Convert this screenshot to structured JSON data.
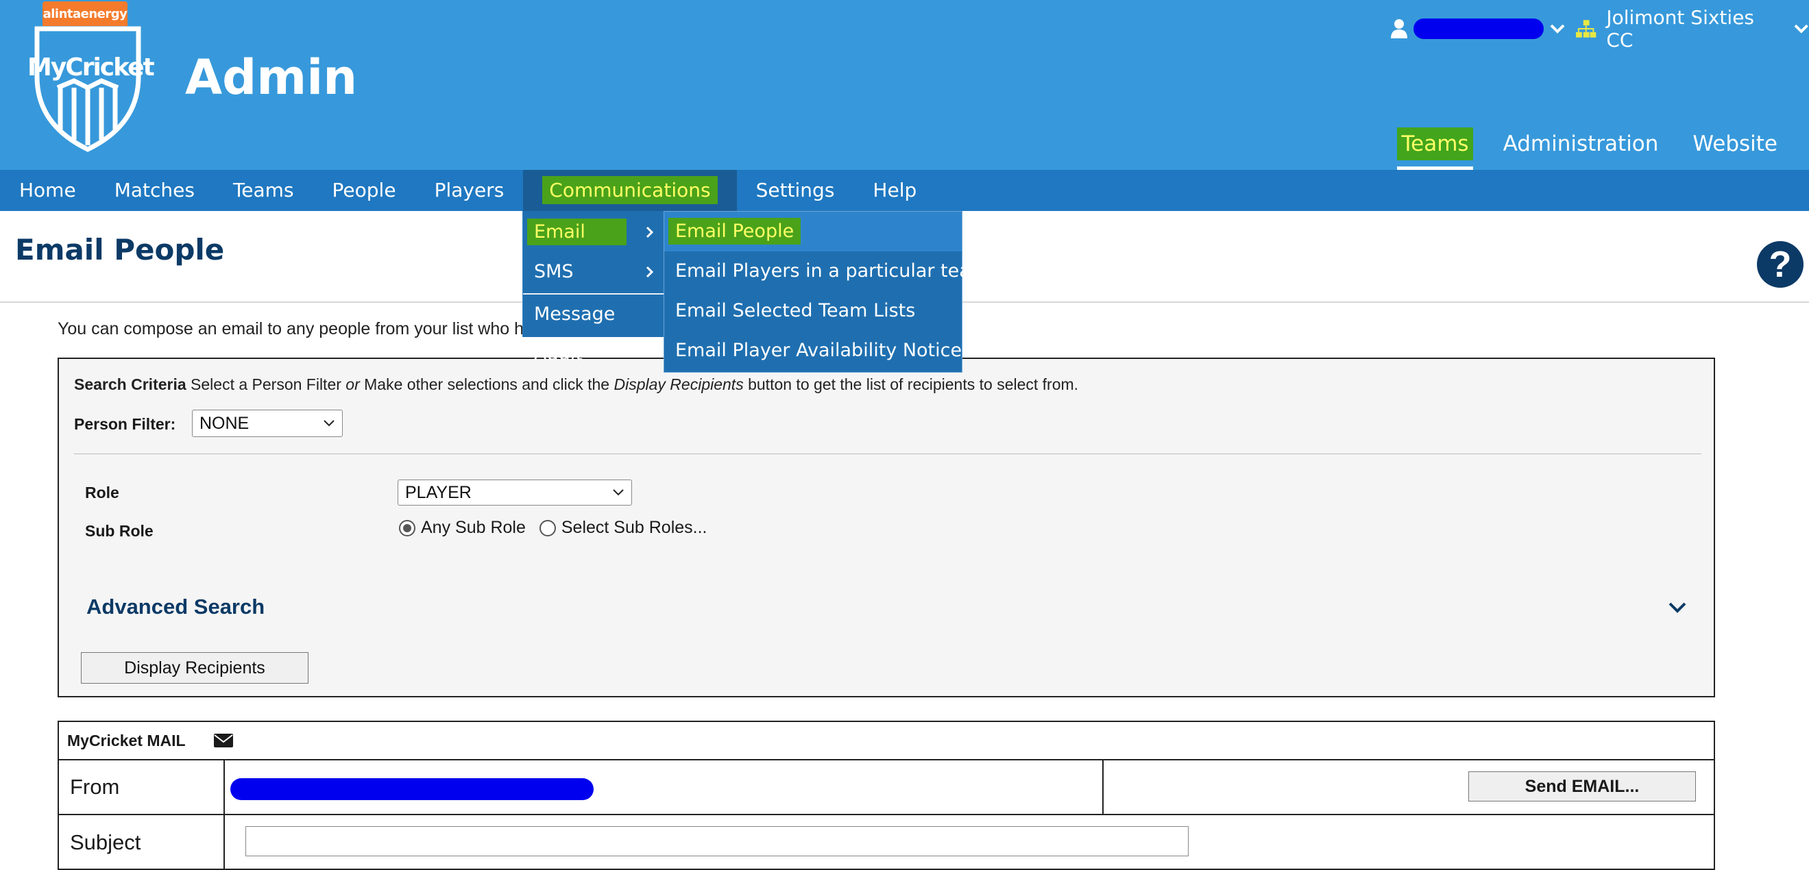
{
  "header": {
    "sponsor": "alintaenergy",
    "logo_text": "MyCricket",
    "app_title": "Admin",
    "user_name_redacted": "",
    "org_name": "Jolimont Sixties CC",
    "top_links": [
      {
        "label": "Teams",
        "active": true
      },
      {
        "label": "Administration",
        "active": false
      },
      {
        "label": "Website",
        "active": false
      }
    ]
  },
  "nav": {
    "items": [
      "Home",
      "Matches",
      "Teams",
      "People",
      "Players",
      "Communications",
      "Settings",
      "Help"
    ],
    "active": "Communications"
  },
  "comm_menu": {
    "items": [
      {
        "label": "Email",
        "has_submenu": true
      },
      {
        "label": "SMS",
        "has_submenu": true
      },
      {
        "label": "Message Audit",
        "has_submenu": false
      }
    ]
  },
  "email_submenu": {
    "items": [
      "Email People",
      "Email Players in a particular team",
      "Email Selected Team Lists",
      "Email Player Availability Notice"
    ]
  },
  "page": {
    "title": "Email People",
    "intro": "You can compose an email to any people from your list who have a valid email address."
  },
  "search": {
    "criteria_bold": "Search Criteria",
    "criteria_text_1": " Select a Person Filter ",
    "criteria_or": "or",
    "criteria_text_2": " Make other selections and click the ",
    "criteria_btn_name": "Display Recipients",
    "criteria_text_3": " button to get the list of recipients to select from.",
    "person_filter_label": "Person Filter:",
    "person_filter_value": "NONE",
    "role_label": "Role",
    "role_value": "PLAYER",
    "subrole_label": "Sub Role",
    "subrole_options": [
      {
        "label": "Any Sub Role",
        "checked": true
      },
      {
        "label": "Select Sub Roles...",
        "checked": false
      }
    ],
    "advanced_label": "Advanced Search",
    "display_button": "Display Recipients"
  },
  "mail": {
    "header": "MyCricket MAIL",
    "from_label": "From",
    "from_value_redacted": "",
    "send_button": "Send EMAIL...",
    "subject_label": "Subject",
    "subject_value": ""
  },
  "colors": {
    "header_bg": "#3799db",
    "nav_bg": "#1f78c1",
    "highlight_green": "#4aa21a",
    "highlight_text": "#ffff66",
    "title_navy": "#0c3a66"
  },
  "icons": [
    "user-icon",
    "org-chart-icon",
    "chevron-down-icon",
    "help-icon",
    "envelope-icon",
    "chevron-right-icon"
  ]
}
